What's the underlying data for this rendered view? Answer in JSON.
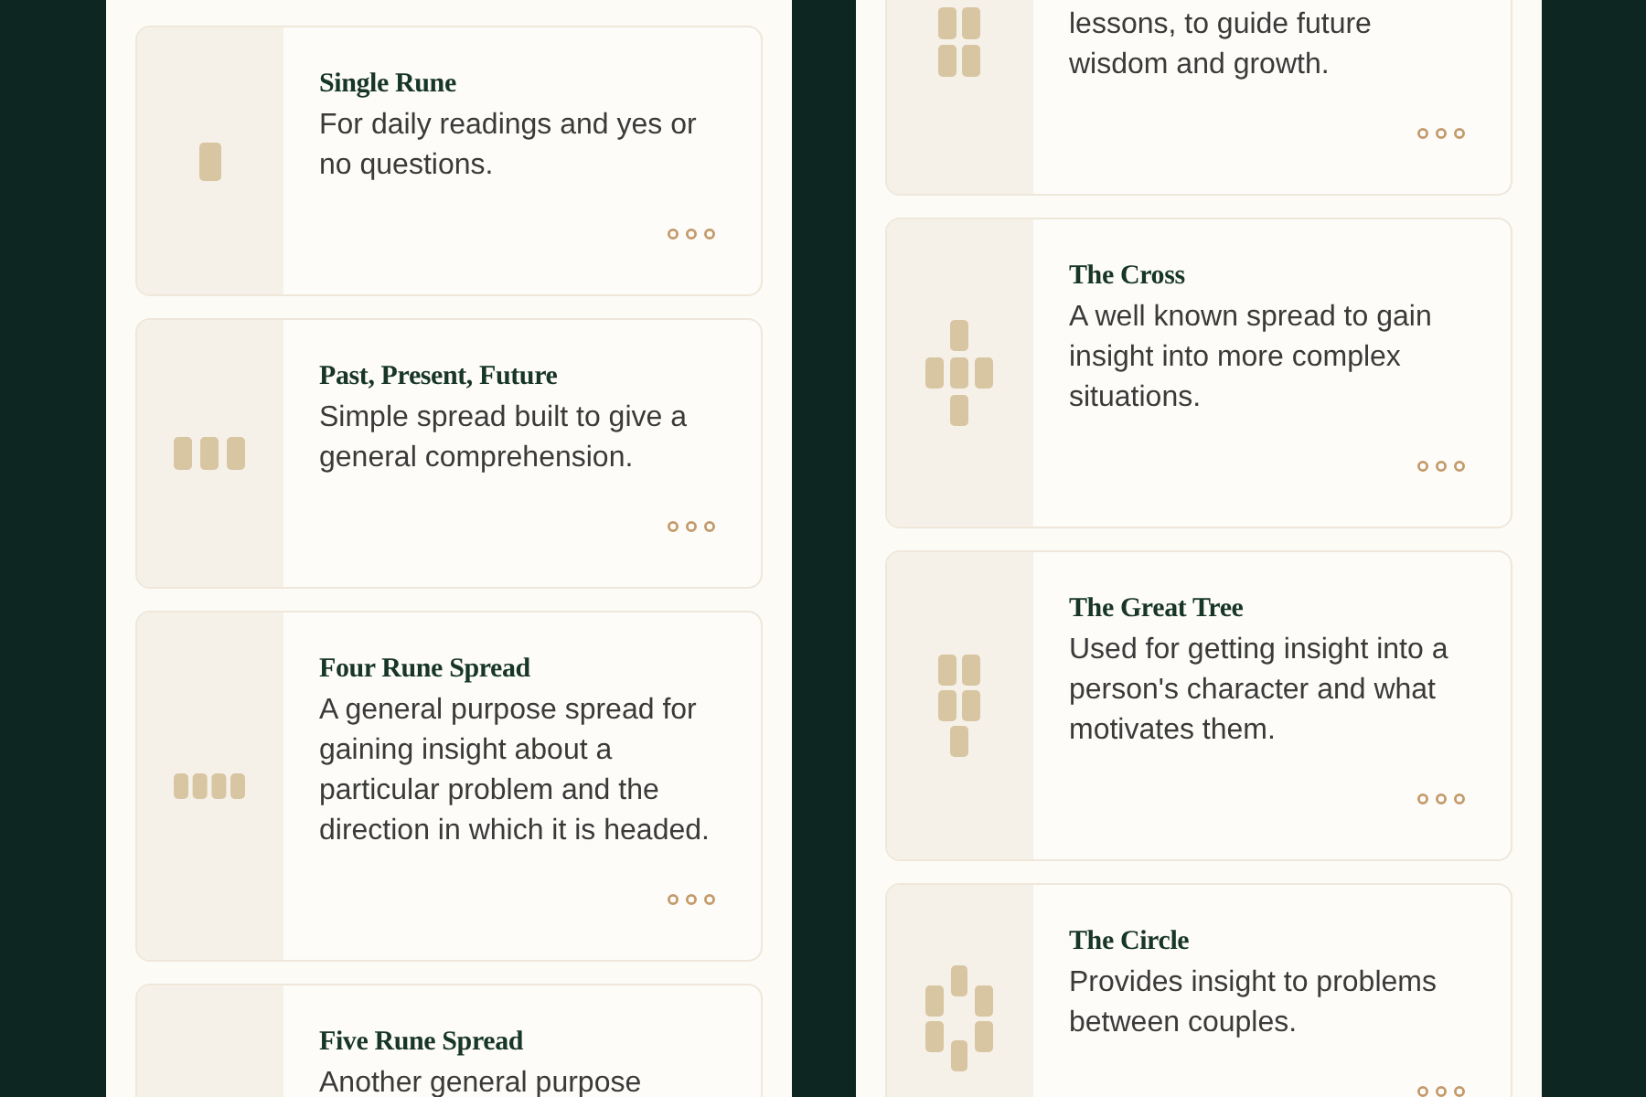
{
  "screens": [
    {
      "cards": [
        {
          "kind": "single",
          "title": "Single Rune",
          "description": "For daily readings and yes or no questions.",
          "more_button": true
        },
        {
          "kind": "three",
          "title": "Past, Present, Future",
          "description": "Simple spread built to give a general comprehension.",
          "more_button": true
        },
        {
          "kind": "four",
          "title": "Four Rune Spread",
          "description": "A general purpose spread for gaining insight about a particular problem and the direction in which it is headed.",
          "more_button": true
        },
        {
          "title": "Five Rune Spread",
          "description": "Another general purpose"
        }
      ]
    },
    {
      "cards": [
        {
          "kind": "square",
          "description": "lessons, to guide future wisdom and growth.",
          "more_button": true
        },
        {
          "kind": "cross",
          "title": "The Cross",
          "description": "A well known spread to gain insight into more complex situations.",
          "more_button": true
        },
        {
          "kind": "tree",
          "title": "The Great Tree",
          "description": "Used for getting insight into a person's character and what motivates them.",
          "more_button": true
        },
        {
          "kind": "circle",
          "title": "The Circle",
          "description": "Provides insight to problems between couples.",
          "more_button": true
        }
      ]
    }
  ]
}
